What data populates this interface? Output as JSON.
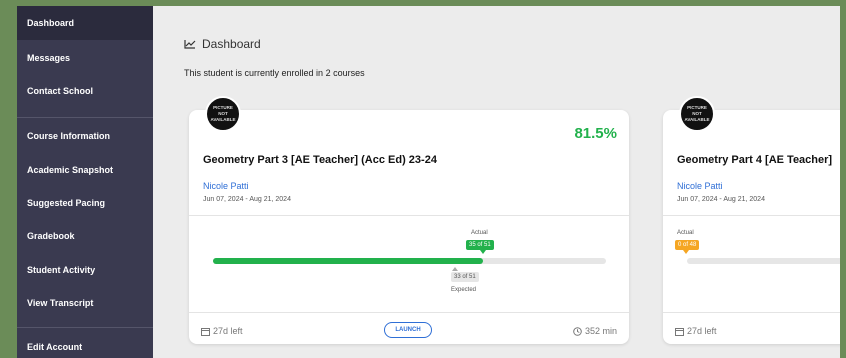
{
  "sidebar": {
    "items": [
      {
        "label": "Dashboard",
        "active": true
      },
      {
        "label": "Messages"
      },
      {
        "label": "Contact School"
      },
      {
        "label": "Course Information"
      },
      {
        "label": "Academic Snapshot"
      },
      {
        "label": "Suggested Pacing"
      },
      {
        "label": "Gradebook"
      },
      {
        "label": "Student Activity"
      },
      {
        "label": "View Transcript"
      },
      {
        "label": "Edit Account"
      }
    ]
  },
  "header": {
    "title": "Dashboard",
    "icon": "chart-line-icon"
  },
  "enrolled_text": "This student is currently enrolled in 2 courses",
  "avatar_text": [
    "PICTURE",
    "NOT",
    "AVAILABLE"
  ],
  "courses": [
    {
      "percent": "81.5%",
      "title": "Geometry Part 3 [AE Teacher] (Acc Ed) 23-24",
      "teacher": "Nicole Patti",
      "dates": "Jun 07, 2024 - Aug 21, 2024",
      "actual_label": "Actual",
      "actual_badge": "35 of 51",
      "actual_progress": 0.686,
      "expected_badge": "33 of 51",
      "expected_label": "Expected",
      "days_left": "27d left",
      "launch_label": "LAUNCH",
      "minutes": "352 min",
      "colors": {
        "actual": "#22b14c"
      }
    },
    {
      "title": "Geometry Part 4 [AE Teacher]",
      "teacher": "Nicole Patti",
      "dates": "Jun 07, 2024 - Aug 21, 2024",
      "actual_label": "Actual",
      "actual_badge": "0 of 48",
      "days_left": "27d left",
      "colors": {
        "actual": "#f5a623"
      }
    }
  ]
}
